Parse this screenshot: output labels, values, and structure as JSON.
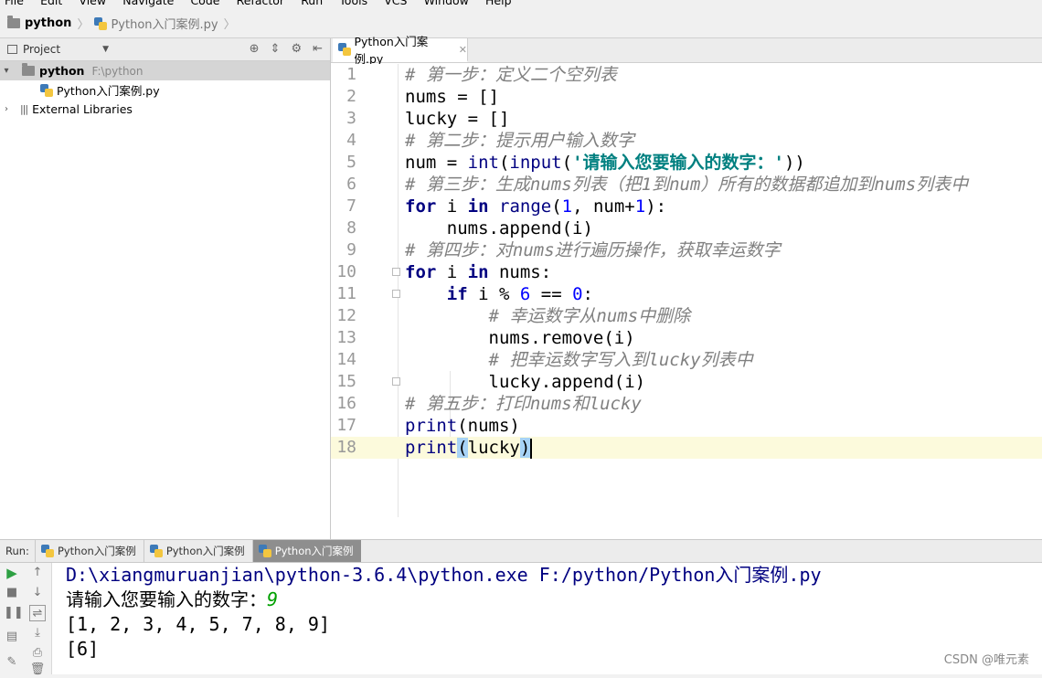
{
  "menu": [
    "File",
    "Edit",
    "View",
    "Navigate",
    "Code",
    "Refactor",
    "Run",
    "Tools",
    "VCS",
    "Window",
    "Help"
  ],
  "breadcrumb": {
    "project": "python",
    "file": "Python入门案例.py"
  },
  "project_panel": {
    "title": "Project",
    "root_name": "python",
    "root_path": "F:\\python",
    "file": "Python入门案例.py",
    "libraries": "External Libraries"
  },
  "editor": {
    "tab_label": "Python入门案例.py",
    "line_numbers": [
      "1",
      "2",
      "3",
      "4",
      "5",
      "6",
      "7",
      "8",
      "9",
      "10",
      "11",
      "12",
      "13",
      "14",
      "15",
      "16",
      "17",
      "18"
    ],
    "lines": {
      "l1_comment": "# 第一步：定义二个空列表",
      "l2": "nums = []",
      "l3": "lucky = []",
      "l4_comment": "# 第二步：提示用户输入数字",
      "l5_a": "num = ",
      "l5_int": "int",
      "l5_b": "(",
      "l5_input": "input",
      "l5_c": "(",
      "l5_str": "'请输入您要输入的数字：'",
      "l5_d": "))",
      "l6_comment": "# 第三步：生成nums列表（把1到num）所有的数据都追加到nums列表中",
      "l7_for": "for",
      "l7_a": " i ",
      "l7_in": "in",
      "l7_b": " ",
      "l7_range": "range",
      "l7_c": "(",
      "l7_n1": "1",
      "l7_d": ", num+",
      "l7_n2": "1",
      "l7_e": "):",
      "l8": "    nums.append(i)",
      "l9_comment": "# 第四步：对nums进行遍历操作，获取幸运数字",
      "l10_for": "for",
      "l10_a": " i ",
      "l10_in": "in",
      "l10_b": " nums:",
      "l11_sp": "    ",
      "l11_if": "if",
      "l11_a": " i % ",
      "l11_n1": "6",
      "l11_b": " == ",
      "l11_n2": "0",
      "l11_c": ":",
      "l12_sp": "        ",
      "l12_comment": "# 幸运数字从nums中删除",
      "l13": "        nums.remove(i)",
      "l14_sp": "        ",
      "l14_comment": "# 把幸运数字写入到lucky列表中",
      "l15": "        lucky.append(i)",
      "l16_comment": "# 第五步：打印nums和lucky",
      "l17_print": "print",
      "l17_a": "(nums)",
      "l18_print": "print",
      "l18_a": "(",
      "l18_b": "lucky",
      "l18_c": ")"
    }
  },
  "run": {
    "label": "Run:",
    "tabs": [
      "Python入门案例",
      "Python入门案例",
      "Python入门案例"
    ],
    "console": {
      "command": "D:\\xiangmuruanjian\\python-3.6.4\\python.exe F:/python/Python入门案例.py",
      "prompt": "请输入您要输入的数字：",
      "input_value": "9",
      "output1": "[1, 2, 3, 4, 5, 7, 8, 9]",
      "output2": "[6]"
    }
  },
  "watermark": "CSDN @唯元素"
}
